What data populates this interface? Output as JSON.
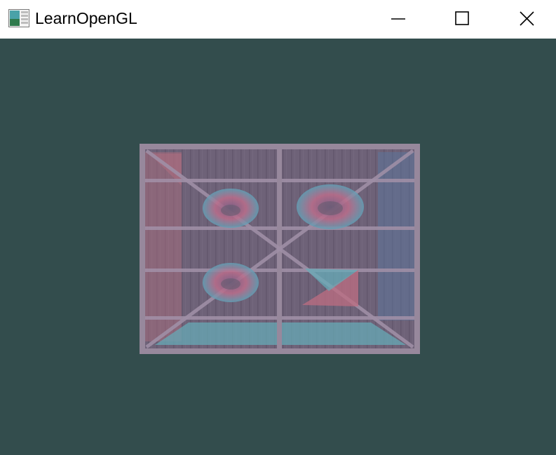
{
  "window": {
    "title": "LearnOpenGL",
    "icon": "app-window-icon",
    "controls": {
      "minimize_icon": "minimize-icon",
      "maximize_icon": "maximize-icon",
      "close_icon": "close-icon"
    }
  },
  "viewport": {
    "clear_color": "#334d4d",
    "scene_description_hidden": true
  },
  "colors": {
    "crate_wood": "#6e5f73",
    "frame": "#9a8a9e",
    "overlay_pink": "#c86a7d",
    "overlay_teal": "#5fb6c0",
    "overlay_blue": "#4f6f9a"
  }
}
